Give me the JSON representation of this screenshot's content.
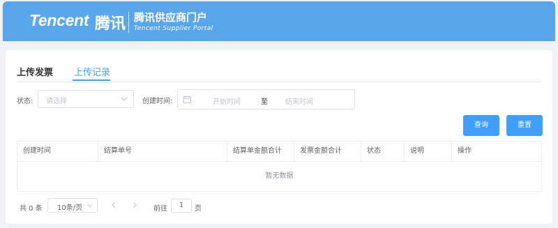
{
  "header": {
    "logo_en": "Tencent",
    "logo_cn": "腾讯",
    "portal_cn": "腾讯供应商门户",
    "portal_en": "Tencent Supplier Portal"
  },
  "tabs": [
    {
      "label": "上传发票",
      "active": false
    },
    {
      "label": "上传记录",
      "active": true
    }
  ],
  "filters": {
    "status_label": "状态:",
    "status_placeholder": "请选择",
    "created_label": "创建时间:",
    "start_placeholder": "开始时间",
    "range_separator": "至",
    "end_placeholder": "结束时间"
  },
  "buttons": {
    "query": "查询",
    "reset": "重置"
  },
  "table": {
    "columns": [
      "创建时间",
      "结算单号",
      "结算单金额合计",
      "发票金额合计",
      "状态",
      "说明",
      "操作"
    ],
    "empty_text": "暂无数据"
  },
  "pagination": {
    "total": "共 0 条",
    "page_size": "10条/页",
    "goto_label": "前往",
    "current_page": "1",
    "page_suffix": "页"
  },
  "colors": {
    "header_bg": "#5aa6ec",
    "primary": "#409eff"
  },
  "icons": [
    "chevron-down-icon",
    "calendar-icon",
    "chevron-left-icon",
    "chevron-right-icon"
  ]
}
